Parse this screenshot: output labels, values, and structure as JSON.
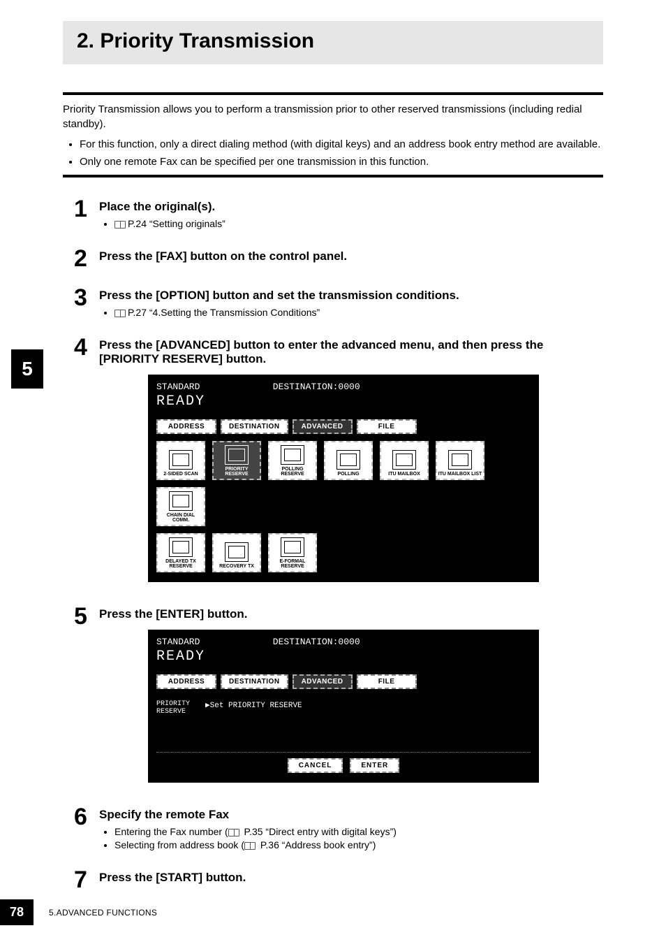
{
  "title": "2. Priority Transmission",
  "intro": "Priority Transmission allows you to perform a transmission prior to other reserved transmissions (including redial standby).",
  "intro_bullets": [
    "For this function, only a direct dialing method (with digital keys) and an address book entry method are available.",
    "Only one remote Fax can be specified per one transmission in this function."
  ],
  "side_tab": "5",
  "steps": [
    {
      "num": "1",
      "title": "Place the original(s).",
      "refs": [
        "P.24 “Setting originals”"
      ]
    },
    {
      "num": "2",
      "title": "Press the [FAX] button on the control panel."
    },
    {
      "num": "3",
      "title": "Press the [OPTION] button and set the transmission conditions.",
      "refs": [
        "P.27 “4.Setting the Transmission Conditions”"
      ]
    },
    {
      "num": "4",
      "title": "Press the [ADVANCED] button to enter the advanced menu, and then press the [PRIORITY RESERVE] button."
    },
    {
      "num": "5",
      "title": "Press the [ENTER] button."
    },
    {
      "num": "6",
      "title": "Specify the remote Fax",
      "subs": [
        "Entering the Fax number (📖 P.35 “Direct entry with digital keys”)",
        "Selecting from address book (📖 P.36 “Address book entry”)"
      ]
    },
    {
      "num": "7",
      "title": "Press the [START] button."
    }
  ],
  "screen1": {
    "top_left": "STANDARD",
    "top_right": "DESTINATION:0000",
    "ready": "READY",
    "tabs": [
      "ADDRESS",
      "DESTINATION",
      "ADVANCED",
      "FILE"
    ],
    "icons_row1": [
      "2-SIDED SCAN",
      "PRIORITY RESERVE",
      "POLLING RESERVE",
      "POLLING",
      "ITU MAILBOX",
      "ITU MAILBOX LIST",
      "CHAIN DIAL COMM."
    ],
    "icons_row2": [
      "DELAYED TX RESERVE",
      "RECOVERY TX",
      "E-FORMAL RESERVE"
    ]
  },
  "screen2": {
    "top_left": "STANDARD",
    "top_right": "DESTINATION:0000",
    "ready": "READY",
    "tabs": [
      "ADDRESS",
      "DESTINATION",
      "ADVANCED",
      "FILE"
    ],
    "left_label": "PRIORITY\nRESERVE",
    "set_text": "▶Set PRIORITY RESERVE",
    "buttons": [
      "CANCEL",
      "ENTER"
    ]
  },
  "footer": {
    "page": "78",
    "section": "5.ADVANCED FUNCTIONS"
  }
}
